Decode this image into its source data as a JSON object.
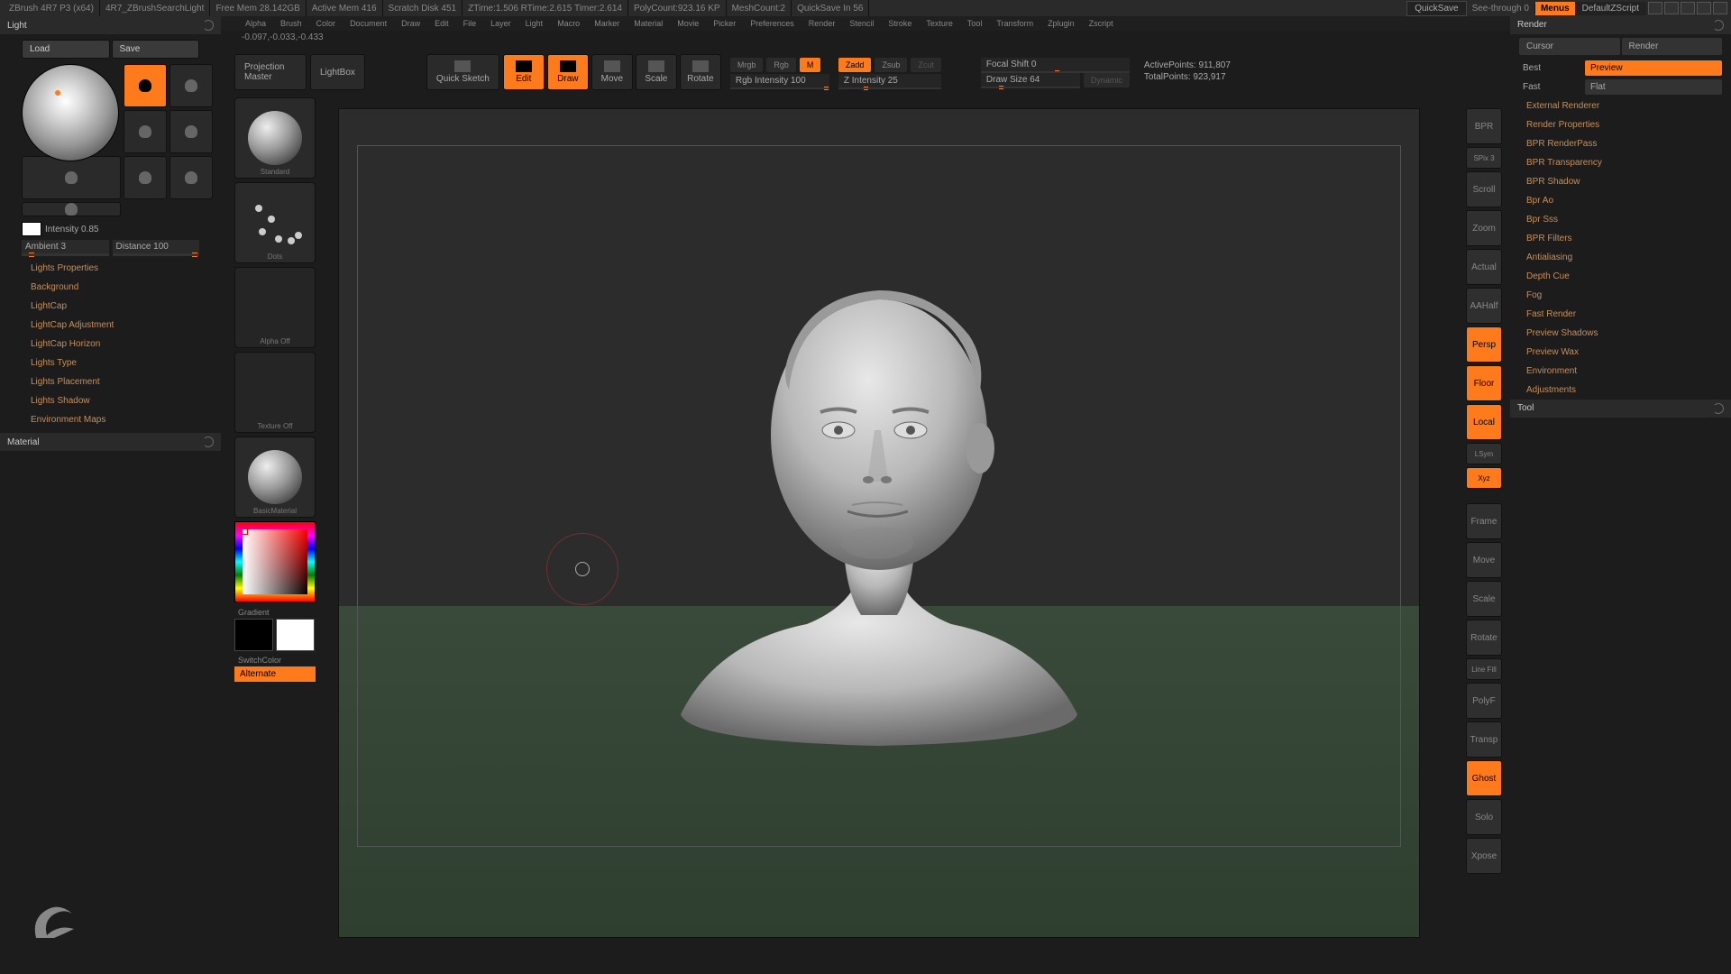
{
  "titlebar": {
    "segments": [
      "ZBrush 4R7 P3 (x64)",
      "4R7_ZBrushSearchLight",
      "Free Mem 28.142GB",
      "Active Mem 416",
      "Scratch Disk 451",
      "ZTime:1.506  RTime:2.615  Timer:2.614",
      "PolyCount:923.16 KP",
      "MeshCount:2",
      "QuickSave In 56"
    ],
    "quicksave": "QuickSave",
    "seethrough": "See-through 0",
    "menus": "Menus",
    "defaultzs": "DefaultZScript"
  },
  "menubar": [
    "Alpha",
    "Brush",
    "Color",
    "Document",
    "Draw",
    "Edit",
    "File",
    "Layer",
    "Light",
    "Macro",
    "Marker",
    "Material",
    "Movie",
    "Picker",
    "Preferences",
    "Render",
    "Stencil",
    "Stroke",
    "Texture",
    "Tool",
    "Transform",
    "Zplugin",
    "Zscript"
  ],
  "left": {
    "light_title": "Light",
    "load": "Load",
    "save": "Save",
    "intensity": "Intensity 0.85",
    "ambient": "Ambient 3",
    "distance": "Distance 100",
    "props": [
      "Lights Properties",
      "Background",
      "LightCap",
      "LightCap Adjustment",
      "LightCap Horizon",
      "Lights Type",
      "Lights Placement",
      "Lights Shadow",
      "Environment Maps"
    ],
    "material_title": "Material"
  },
  "toolcol": {
    "standard": "Standard",
    "dots": "Dots",
    "alpha": "Alpha Off",
    "texture": "Texture Off",
    "material": "BasicMaterial",
    "gradient": "Gradient",
    "switch": "SwitchColor",
    "alternate": "Alternate"
  },
  "top": {
    "coords": "-0.097,-0.033,-0.433",
    "projection": "Projection Master",
    "lightbox": "LightBox",
    "quicksketch": "Quick Sketch",
    "edit": "Edit",
    "draw": "Draw",
    "move": "Move",
    "scale": "Scale",
    "rotate": "Rotate",
    "mrgb": "Mrgb",
    "rgb": "Rgb",
    "m": "M",
    "rgbint": "Rgb Intensity 100",
    "zadd": "Zadd",
    "zsub": "Zsub",
    "zcut": "Zcut",
    "zint": "Z Intensity 25",
    "focal": "Focal Shift 0",
    "drawsize": "Draw Size 64",
    "dynamic": "Dynamic",
    "active": "ActivePoints: 911,807",
    "total": "TotalPoints: 923,917"
  },
  "shelf": {
    "bpr": "BPR",
    "spix": "SPix 3",
    "scroll": "Scroll",
    "zoom": "Zoom",
    "actual": "Actual",
    "aahalf": "AAHalf",
    "persp": "Persp",
    "floor": "Floor",
    "local": "Local",
    "lsym": "LSym",
    "xyz": "Xyz",
    "frame": "Frame",
    "move": "Move",
    "scale": "Scale",
    "rotate": "Rotate",
    "linefill": "Line Fill",
    "polyf": "PolyF",
    "transp": "Transp",
    "ghost": "Ghost",
    "solo": "Solo",
    "xpose": "Xpose"
  },
  "right": {
    "render_title": "Render",
    "cursor": "Cursor",
    "render": "Render",
    "best": "Best",
    "preview": "Preview",
    "fast": "Fast",
    "flat": "Flat",
    "items": [
      "External Renderer",
      "Render Properties",
      "BPR RenderPass",
      "BPR Transparency",
      "BPR Shadow",
      "Bpr Ao",
      "Bpr Sss",
      "BPR Filters",
      "Antialiasing",
      "Depth Cue",
      "Fog",
      "Fast Render",
      "Preview Shadows",
      "Preview Wax",
      "Environment",
      "Adjustments"
    ],
    "tool_title": "Tool"
  }
}
